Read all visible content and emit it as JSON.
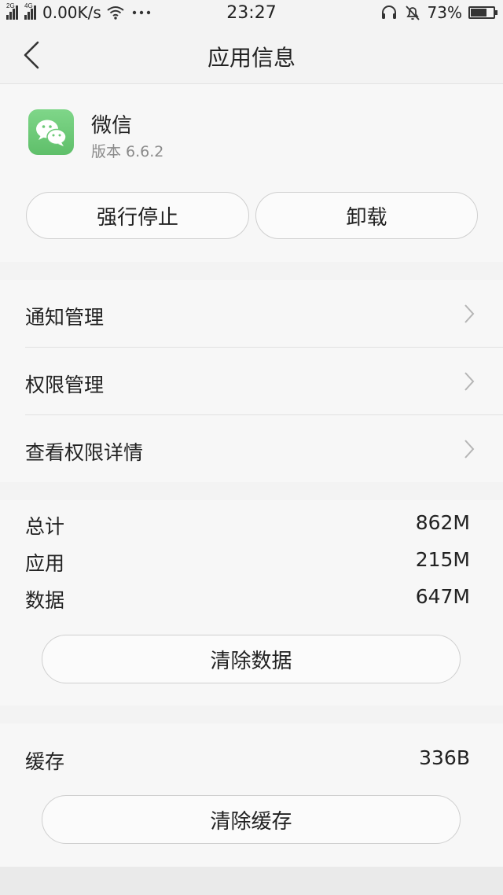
{
  "status_bar": {
    "net_left": "2G",
    "net_right": "4G",
    "speed": "0.00K/s",
    "time": "23:27",
    "battery_percent": "73%",
    "battery_level": 0.73,
    "icons": [
      "signal-icon",
      "wifi-icon",
      "more-icon",
      "headset-icon",
      "mute-icon",
      "battery-icon"
    ]
  },
  "header": {
    "title": "应用信息"
  },
  "app": {
    "name": "微信",
    "version": "版本 6.6.2",
    "icon": "wechat-icon",
    "brand_color": "#6bc977"
  },
  "actions": {
    "force_stop": "强行停止",
    "uninstall": "卸载"
  },
  "menu": [
    {
      "label": "通知管理"
    },
    {
      "label": "权限管理"
    },
    {
      "label": "查看权限详情"
    }
  ],
  "storage": {
    "rows": [
      {
        "label": "总计",
        "value": "862M"
      },
      {
        "label": "应用",
        "value": "215M"
      },
      {
        "label": "数据",
        "value": "647M"
      }
    ],
    "clear_data": "清除数据"
  },
  "cache": {
    "label": "缓存",
    "value": "336B",
    "clear_cache": "清除缓存"
  }
}
